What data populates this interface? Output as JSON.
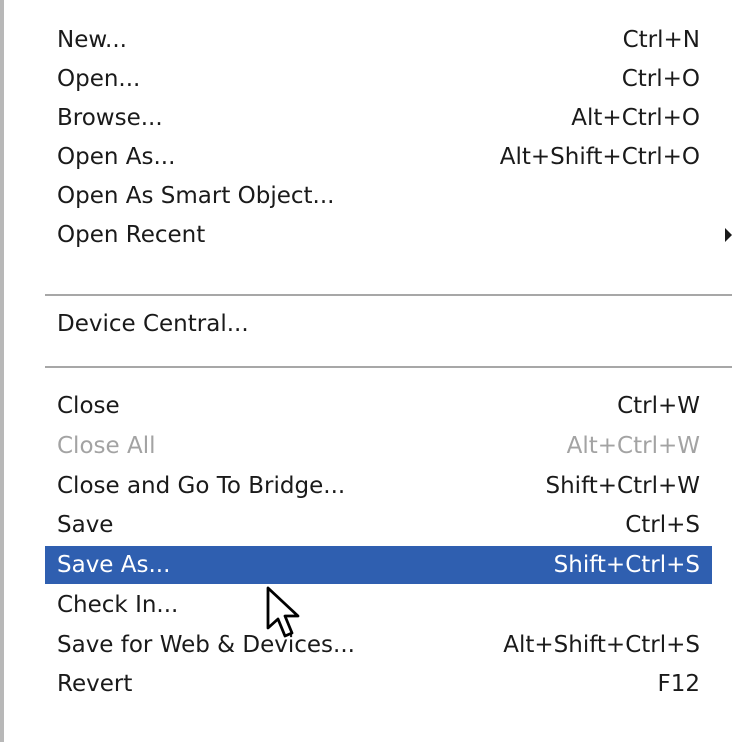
{
  "menu": {
    "items": [
      {
        "label": "New...",
        "shortcut": "Ctrl+N"
      },
      {
        "label": "Open...",
        "shortcut": "Ctrl+O"
      },
      {
        "label": "Browse...",
        "shortcut": "Alt+Ctrl+O"
      },
      {
        "label": "Open As...",
        "shortcut": "Alt+Shift+Ctrl+O"
      },
      {
        "label": "Open As Smart Object...",
        "shortcut": ""
      },
      {
        "label": "Open Recent",
        "shortcut": ""
      },
      {
        "label": "Device Central...",
        "shortcut": ""
      },
      {
        "label": "Close",
        "shortcut": "Ctrl+W"
      },
      {
        "label": "Close All",
        "shortcut": "Alt+Ctrl+W",
        "disabled": true
      },
      {
        "label": "Close and Go To Bridge...",
        "shortcut": "Shift+Ctrl+W"
      },
      {
        "label": "Save",
        "shortcut": "Ctrl+S"
      },
      {
        "label": "Save As...",
        "shortcut": "Shift+Ctrl+S",
        "highlighted": true
      },
      {
        "label": "Check In...",
        "shortcut": ""
      },
      {
        "label": "Save for Web & Devices...",
        "shortcut": "Alt+Shift+Ctrl+S"
      },
      {
        "label": "Revert",
        "shortcut": "F12"
      }
    ]
  },
  "colors": {
    "highlight": "#2f5fb0",
    "disabled_text": "#a3a3a3",
    "separator": "#a7a7a7"
  },
  "icons": {
    "submenu_arrow": "triangle-right-icon",
    "cursor": "mouse-pointer-icon"
  }
}
